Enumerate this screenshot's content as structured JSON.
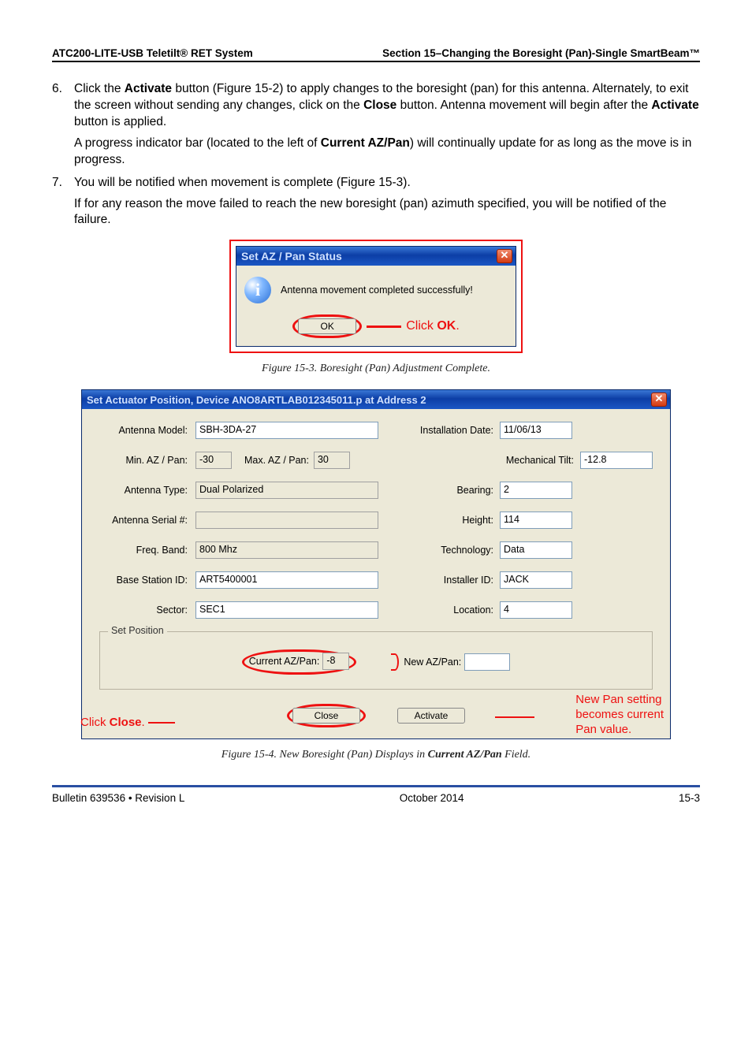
{
  "header": {
    "left": "ATC200-LITE-USB Teletilt® RET System",
    "right": "Section 15–Changing the Boresight (Pan)-Single SmartBeam™"
  },
  "step6": {
    "num": "6.",
    "p1a": "Click the ",
    "b1": "Activate",
    "p1b": " button (Figure 15-2) to apply changes to the boresight (pan) for this antenna. Alternately, to exit the screen without sending any changes, click on the ",
    "b2": "Close",
    "p1c": " button. Antenna movement will begin after the ",
    "b3": "Activate",
    "p1d": " button is applied.",
    "p2a": "A progress indicator bar (located to the left of ",
    "b4": "Current AZ/Pan",
    "p2b": ") will continually update for as long as the move is in progress."
  },
  "step7": {
    "num": "7.",
    "p1": "You will be notified when movement is complete (Figure 15-3).",
    "p2": "If for any reason the move failed to reach the new boresight (pan) azimuth specified, you will be notified of the failure."
  },
  "dlg1": {
    "title": "Set AZ / Pan Status",
    "close_glyph": "✕",
    "info_glyph": "i",
    "message": "Antenna movement completed successfully!",
    "ok_label": "OK",
    "click_prefix": "Click ",
    "click_ok": "OK",
    "click_suffix": "."
  },
  "figcap1": "Figure 15-3. Boresight (Pan) Adjustment Complete.",
  "dlg2": {
    "title": "Set Actuator Position, Device ANO8ARTLAB012345011.p  at Address 2",
    "close_glyph": "✕",
    "labels": {
      "antenna_model": "Antenna Model:",
      "installation_date": "Installation Date:",
      "min_az": "Min. AZ / Pan:",
      "max_az": "Max. AZ / Pan:",
      "mech_tilt": "Mechanical Tilt:",
      "antenna_type": "Antenna Type:",
      "bearing": "Bearing:",
      "serial": "Antenna Serial #:",
      "height": "Height:",
      "freq": "Freq. Band:",
      "tech": "Technology:",
      "bsid": "Base Station ID:",
      "installer": "Installer ID:",
      "sector": "Sector:",
      "location": "Location:",
      "group": "Set Position",
      "current_az": "Current AZ/Pan:",
      "new_az": "New AZ/Pan:",
      "close_btn": "Close",
      "activate_btn": "Activate"
    },
    "values": {
      "antenna_model": "SBH-3DA-27",
      "installation_date": "11/06/13",
      "min_az": "-30",
      "max_az": "30",
      "mech_tilt": "-12.8",
      "antenna_type": "Dual Polarized",
      "bearing": "2",
      "serial": "",
      "height": "114",
      "freq": "800  Mhz",
      "tech": "Data",
      "bsid": "ART5400001",
      "installer": "JACK",
      "sector": "SEC1",
      "location": "4",
      "current_az": "-8",
      "new_az": ""
    },
    "annot": {
      "click_close_pre": "Click ",
      "click_close_b": "Close",
      "click_close_suf": ".",
      "nps1": "New Pan setting",
      "nps2": "becomes current",
      "nps3": "Pan value."
    }
  },
  "figcap2_a": "Figure 15-4. New Boresight (Pan) Displays in ",
  "figcap2_b": "Current AZ/Pan",
  "figcap2_c": " Field.",
  "footer": {
    "left": "Bulletin 639536  •  Revision L",
    "center": "October 2014",
    "right": "15-3"
  }
}
